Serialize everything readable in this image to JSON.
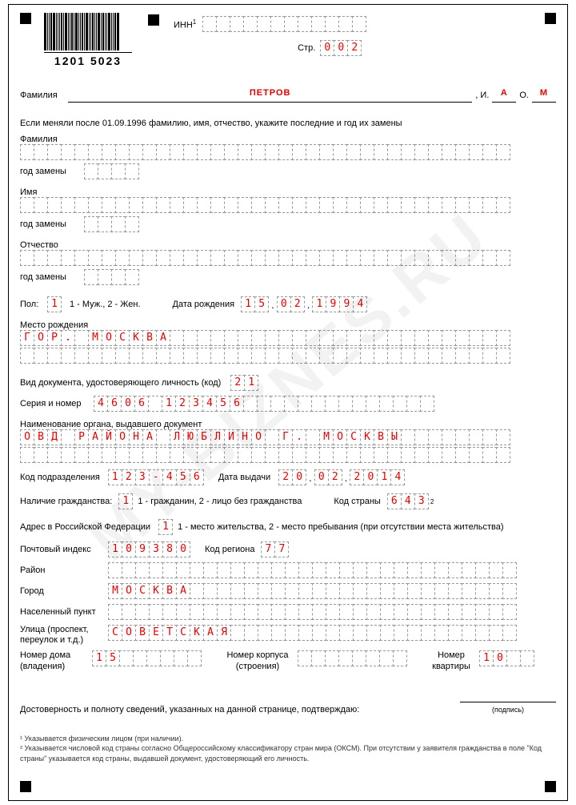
{
  "watermark": "MY-BIZNES.RU",
  "header": {
    "inn_label": "ИНН",
    "inn": [
      "",
      "",
      "",
      "",
      "",
      "",
      "",
      "",
      "",
      "",
      "",
      ""
    ],
    "page_label": "Стр.",
    "page": [
      "0",
      "0",
      "2"
    ],
    "barcode_number": "1201 5023"
  },
  "surname_line": {
    "label": "Фамилия",
    "surname": "ПЕТРОВ",
    "i_label": ", И.",
    "i": "А",
    "o_label": "О.",
    "o": "М"
  },
  "name_change": {
    "instruction": "Если меняли после 01.09.1996 фамилию, имя, отчество, укажите последние и год их замены",
    "surname_label": "Фамилия",
    "year_label": "год замены",
    "name_label": "Имя",
    "patronymic_label": "Отчество"
  },
  "sex": {
    "label": "Пол:",
    "value": [
      "1"
    ],
    "legend": "1 - Муж., 2 - Жен."
  },
  "dob": {
    "label": "Дата рождения",
    "d": [
      "1",
      "5"
    ],
    "m": [
      "0",
      "2"
    ],
    "y": [
      "1",
      "9",
      "9",
      "4"
    ]
  },
  "birthplace": {
    "label": "Место рождения",
    "value": "ГОР. МОСКВА"
  },
  "doc": {
    "type_label": "Вид документа, удостоверяющего личность (код)",
    "type": [
      "2",
      "1"
    ],
    "series_label": "Серия и номер",
    "series": "4606 123456",
    "issuer_label": "Наименование органа, выдавшего документ",
    "issuer": "ОВД РАЙОНА ЛЮБЛИНО Г. МОСКВЫ",
    "unit_label": "Код подразделения",
    "unit": "123-456",
    "issue_date_label": "Дата выдачи",
    "issue_d": [
      "2",
      "0"
    ],
    "issue_m": [
      "0",
      "2"
    ],
    "issue_y": [
      "2",
      "0",
      "1",
      "4"
    ]
  },
  "citizenship": {
    "label": "Наличие гражданства:",
    "value": [
      "1"
    ],
    "legend": "1 - гражданин, 2 - лицо без гражданства",
    "country_label": "Код страны",
    "country": [
      "6",
      "4",
      "3"
    ]
  },
  "address": {
    "label": "Адрес в Российской Федерации",
    "type": [
      "1"
    ],
    "type_legend": "1 - место жительства, 2 - место пребывания (при отсутствии места жительства)",
    "postcode_label": "Почтовый индекс",
    "postcode": [
      "1",
      "0",
      "9",
      "3",
      "8",
      "0"
    ],
    "region_label": "Код региона",
    "region": [
      "7",
      "7"
    ],
    "district_label": "Район",
    "city_label": "Город",
    "city": "МОСКВА",
    "settlement_label": "Населенный пункт",
    "street_label": "Улица (проспект, переулок и т.д.)",
    "street": "СОВЕТСКАЯ",
    "house_label": "Номер дома (владения)",
    "house": [
      "1",
      "5"
    ],
    "building_label": "Номер корпуса (строения)",
    "flat_label": "Номер квартиры",
    "flat": [
      "1",
      "0"
    ]
  },
  "confirm": {
    "text": "Достоверность и полноту сведений, указанных на данной странице, подтверждаю:",
    "sig_label": "(подпись)"
  },
  "footnotes": {
    "f1": "¹ Указывается физическим лицом (при наличии).",
    "f2": "² Указывается числовой код страны согласно Общероссийскому классификатору стран мира (ОКСМ). При отсутствии у заявителя гражданства в поле \"Код страны\" указывается код страны, выдавшей документ, удостоверяющий его личность."
  }
}
